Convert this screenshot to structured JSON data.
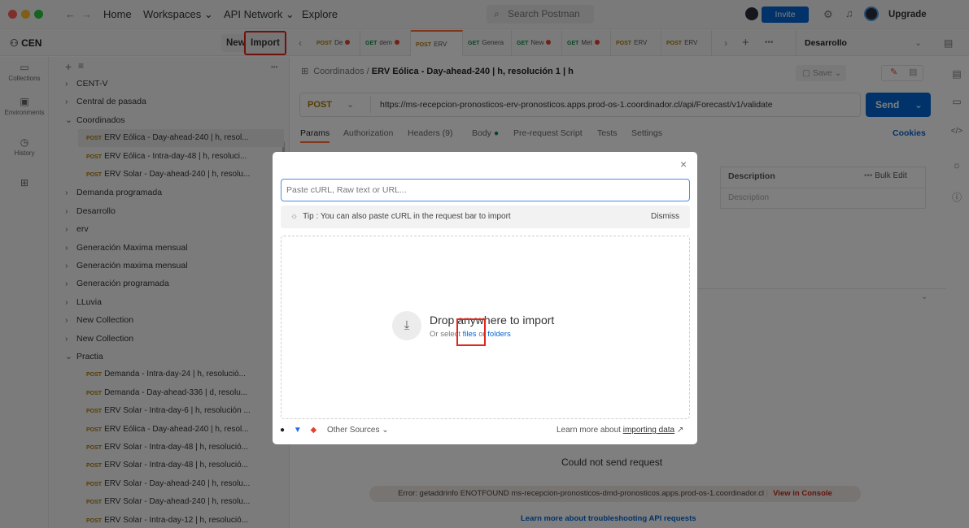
{
  "topbar": {
    "nav": [
      "Home",
      "Workspaces",
      "API Network",
      "Explore"
    ],
    "search_placeholder": "Search Postman",
    "invite_label": "Invite",
    "upgrade_label": "Upgrade"
  },
  "workspace": {
    "name": "CEN",
    "new_label": "New",
    "import_label": "Import"
  },
  "tabs": [
    {
      "method": "POST",
      "label": "De",
      "dot": true
    },
    {
      "method": "GET",
      "label": "dem",
      "dot": true
    },
    {
      "method": "POST",
      "label": "ERV",
      "dot": false
    },
    {
      "method": "GET",
      "label": "Genera",
      "dot": false
    },
    {
      "method": "GET",
      "label": "New",
      "dot": true
    },
    {
      "method": "GET",
      "label": "Met",
      "dot": true
    },
    {
      "method": "POST",
      "label": "ERV",
      "dot": false
    },
    {
      "method": "POST",
      "label": "ERV",
      "dot": false
    }
  ],
  "environment": "Desarrollo",
  "rail": {
    "collections": "Collections",
    "environments": "Environments",
    "history": "History"
  },
  "sidebar": {
    "items": [
      {
        "label": "CENT-V",
        "type": "folder"
      },
      {
        "label": "Central de pasada",
        "type": "folder"
      },
      {
        "label": "Coordinados",
        "type": "folder-open"
      },
      {
        "label": "ERV Eólica - Day-ahead-240 | h, resol...",
        "type": "req",
        "method": "POST",
        "selected": true
      },
      {
        "label": "ERV Eólica - Intra-day-48 | h, resoluci...",
        "type": "req",
        "method": "POST"
      },
      {
        "label": "ERV Solar - Day-ahead-240 | h, resolu...",
        "type": "req",
        "method": "POST"
      },
      {
        "label": "Demanda programada",
        "type": "folder"
      },
      {
        "label": "Desarrollo",
        "type": "folder"
      },
      {
        "label": "erv",
        "type": "folder"
      },
      {
        "label": "Generación Maxima mensual",
        "type": "folder"
      },
      {
        "label": "Generación maxima mensual",
        "type": "folder"
      },
      {
        "label": "Generación programada",
        "type": "folder"
      },
      {
        "label": "LLuvia",
        "type": "folder"
      },
      {
        "label": "New Collection",
        "type": "folder"
      },
      {
        "label": "New Collection",
        "type": "folder"
      },
      {
        "label": "Practia",
        "type": "folder-open"
      },
      {
        "label": "Demanda - Intra-day-24 | h, resolució...",
        "type": "req",
        "method": "POST"
      },
      {
        "label": "Demanda - Day-ahead-336 | d, resolu...",
        "type": "req",
        "method": "POST"
      },
      {
        "label": "ERV Solar - Intra-day-6 | h, resolución ...",
        "type": "req",
        "method": "POST"
      },
      {
        "label": "ERV Eólica - Day-ahead-240 | h, resol...",
        "type": "req",
        "method": "POST"
      },
      {
        "label": "ERV Solar - Intra-day-48 | h, resolució...",
        "type": "req",
        "method": "POST"
      },
      {
        "label": "ERV Solar - Intra-day-48 | h, resolució...",
        "type": "req",
        "method": "POST"
      },
      {
        "label": "ERV Solar - Day-ahead-240 | h, resolu...",
        "type": "req",
        "method": "POST"
      },
      {
        "label": "ERV Solar - Day-ahead-240 | h, resolu...",
        "type": "req",
        "method": "POST"
      },
      {
        "label": "ERV Solar - Intra-day-12 | h, resolució...",
        "type": "req",
        "method": "POST"
      }
    ]
  },
  "request": {
    "breadcrumb_parent": "Coordinados",
    "breadcrumb_sep": "/",
    "breadcrumb_title": "ERV Eólica - Day-ahead-240 | h, resolución 1 | h",
    "save_label": "Save",
    "method": "POST",
    "url": "https://ms-recepcion-pronosticos-erv-pronosticos.apps.prod-os-1.coordinador.cl/api/Forecast/v1/validate",
    "send_label": "Send",
    "tabs": [
      "Params",
      "Authorization",
      "Headers (9)",
      "Body",
      "Pre-request Script",
      "Tests",
      "Settings"
    ],
    "cookies_label": "Cookies",
    "desc_header": "Description",
    "bulk_edit": "Bulk Edit",
    "desc_placeholder": "Description"
  },
  "response": {
    "could_not_send": "Could not send request",
    "error_text": "Error: getaddrinfo ENOTFOUND ms-recepcion-pronosticos-dmd-pronosticos.apps.prod-os-1.coordinador.cl",
    "view_console": "View in Console",
    "learn_more": "Learn more about troubleshooting API requests"
  },
  "import_dialog": {
    "paste_placeholder": "Paste cURL, Raw text or URL...",
    "tip": "Tip : You can also paste cURL in the request bar to import",
    "dismiss": "Dismiss",
    "drop_title": "Drop anywhere to import",
    "drop_sub_prefix": "Or select",
    "files_link": "files",
    "or": "or",
    "folders_link": "folders",
    "other_sources": "Other Sources",
    "learn_prefix": "Learn more about",
    "learn_link": "importing data"
  }
}
